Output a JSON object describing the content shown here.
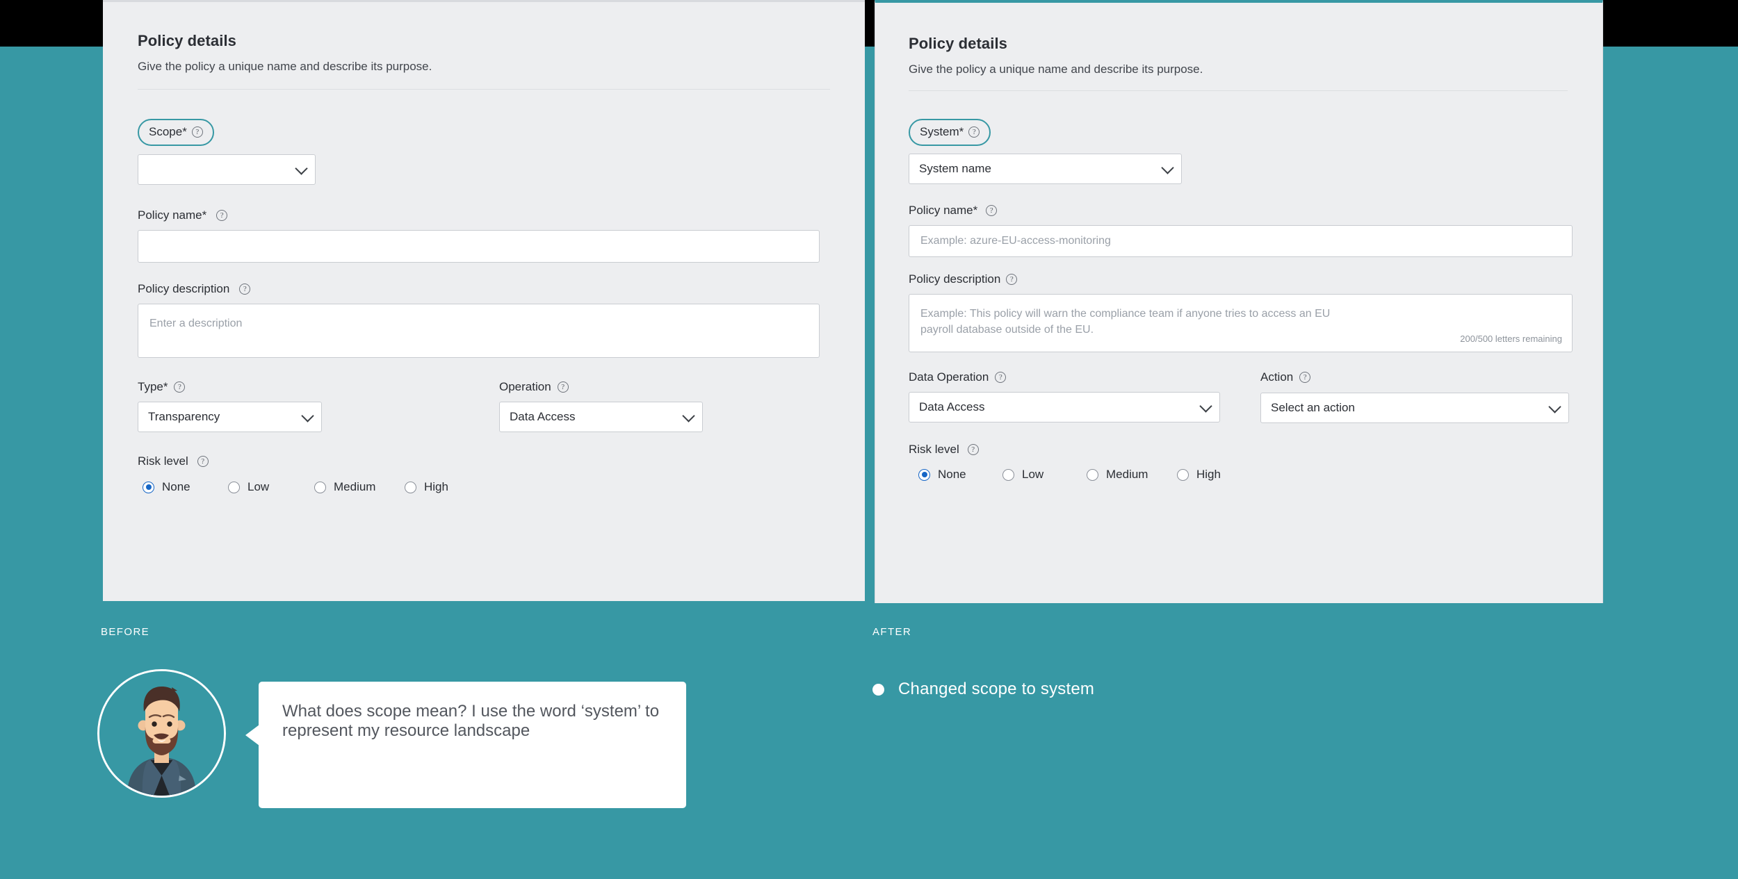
{
  "theme": {
    "background_teal": "#3798a4",
    "panel_bg": "#edeef0",
    "highlight_outline": "#3798a4",
    "radio_accent": "#1666c6",
    "band_black": "#000000"
  },
  "before_panel": {
    "title": "Policy details",
    "subtitle": "Give the policy a unique name and describe its purpose.",
    "scope": {
      "label": "Scope*",
      "help_icon": "question-circle-icon",
      "value": "",
      "highlighted": true
    },
    "policy_name": {
      "label": "Policy name*",
      "help_icon": "question-circle-icon",
      "value": "",
      "placeholder": ""
    },
    "policy_description": {
      "label": "Policy description",
      "help_icon": "question-circle-icon",
      "value": "",
      "placeholder": "Enter a description"
    },
    "type": {
      "label": "Type*",
      "help_icon": "question-circle-icon",
      "value": "Transparency"
    },
    "operation": {
      "label": "Operation",
      "help_icon": "question-circle-icon",
      "value": "Data Access"
    },
    "risk_level": {
      "label": "Risk level",
      "help_icon": "question-circle-icon",
      "options": [
        "None",
        "Low",
        "Medium",
        "High"
      ],
      "selected": "None"
    }
  },
  "after_panel": {
    "title": "Policy details",
    "subtitle": "Give the policy a unique name and describe its purpose.",
    "system": {
      "label": "System*",
      "help_icon": "question-circle-icon",
      "value": "System name",
      "highlighted": true
    },
    "policy_name": {
      "label": "Policy name*",
      "help_icon": "question-circle-icon",
      "value": "",
      "placeholder": "Example: azure-EU-access-monitoring"
    },
    "policy_description": {
      "label": "Policy description",
      "help_icon": "question-circle-icon",
      "value": "",
      "placeholder_line1": "Example: This policy will warn the compliance team if anyone tries to access an EU",
      "placeholder_line2": "payroll database outside of the EU.",
      "counter": "200/500 letters remaining"
    },
    "data_operation": {
      "label": "Data Operation",
      "help_icon": "question-circle-icon",
      "value": "Data Access"
    },
    "action": {
      "label": "Action",
      "help_icon": "question-circle-icon",
      "value": "Select an action"
    },
    "risk_level": {
      "label": "Risk level",
      "help_icon": "question-circle-icon",
      "options": [
        "None",
        "Low",
        "Medium",
        "High"
      ],
      "selected": "None"
    }
  },
  "annotations": {
    "before_label": "BEFORE",
    "after_label": "AFTER",
    "avatar_icon": "user-avatar-bearded-man-illustration",
    "quote": "What does scope mean? I use the word ‘system’ to represent my resource landscape",
    "changes": [
      {
        "bullet_icon": "bullet-dot-icon",
        "text": "Changed scope to system"
      }
    ]
  }
}
